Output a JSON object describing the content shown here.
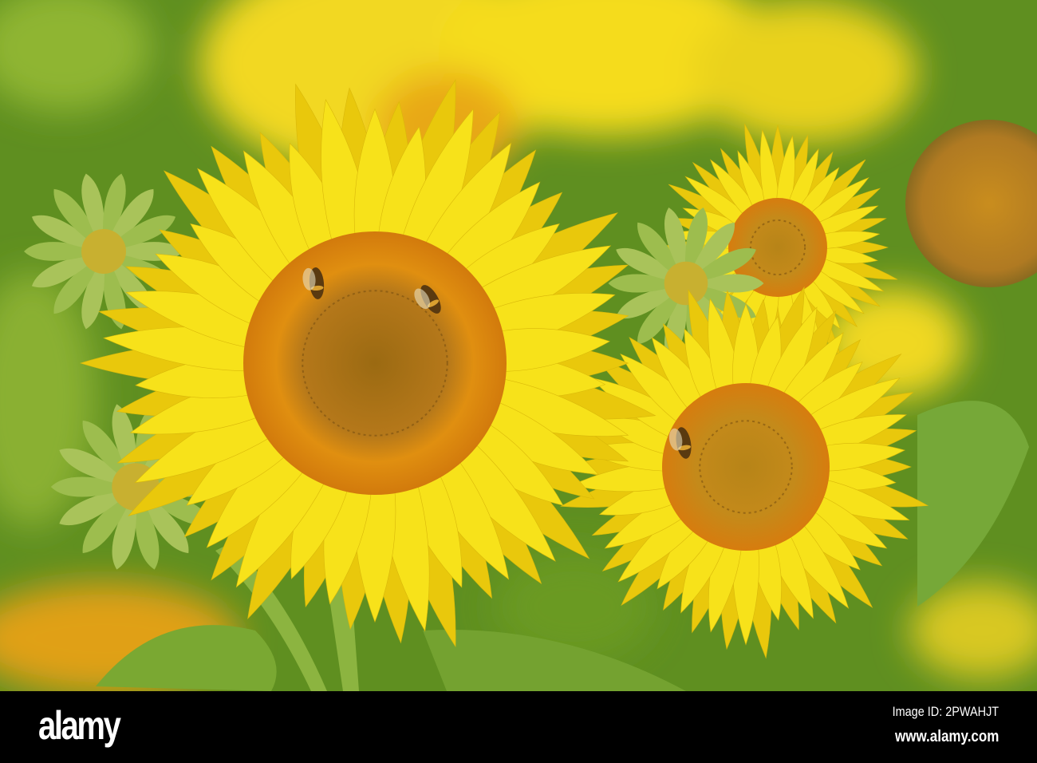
{
  "photo": {
    "subject": "sunflowers-with-bees",
    "colors": {
      "petal": "#f7e21a",
      "petal_dark": "#e9c80c",
      "disk": "#d98a12",
      "disk_center": "#a86a10",
      "leaf": "#6f9a2a",
      "background": "#5e8a1e",
      "bud": "#a9c35a"
    }
  },
  "watermark": {
    "logo": "alamy",
    "image_id": "Image ID: 2PWAHJT",
    "website": "www.alamy.com"
  }
}
